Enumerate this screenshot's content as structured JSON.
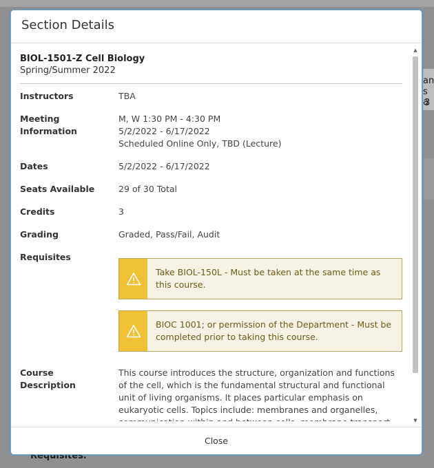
{
  "dialog": {
    "title": "Section Details",
    "close_label": "Close"
  },
  "course": {
    "code_title": "BIOL-1501-Z Cell Biology",
    "term": "Spring/Summer 2022"
  },
  "fields": {
    "instructors": {
      "label": "Instructors",
      "value": "TBA"
    },
    "meeting": {
      "label_line1": "Meeting",
      "label_line2": "Information",
      "line1": "M, W 1:30 PM - 4:30 PM",
      "line2": "5/2/2022 - 6/17/2022",
      "line3": "Scheduled Online Only, TBD (Lecture)"
    },
    "dates": {
      "label": "Dates",
      "value": "5/2/2022 - 6/17/2022"
    },
    "seats": {
      "label": "Seats Available",
      "value": "29 of 30 Total"
    },
    "credits": {
      "label": "Credits",
      "value": "3"
    },
    "grading": {
      "label": "Grading",
      "value": "Graded, Pass/Fail, Audit"
    },
    "requisites": {
      "label": "Requisites",
      "items": [
        "Take BIOL-150L - Must be taken at the same time as this course.",
        "BIOC 1001; or permission of the Department - Must be completed prior to taking this course."
      ]
    },
    "description": {
      "label_line1": "Course",
      "label_line2": "Description",
      "value": "This course introduces the structure, organization and functions of the cell, which is the fundamental structural and functional unit of living organisms. It places particular emphasis on eukaryotic cells. Topics include: membranes and organelles, communication within and between cells, membrane transport, the cell cycle, meiosis"
    }
  },
  "background": {
    "right_fragments": [
      "an",
      "s a",
      "3"
    ],
    "bottom_label": "Requisites:"
  },
  "colors": {
    "accent_border": "#6aa9dd",
    "warning_fill": "#f0c233",
    "warning_bg": "#f6f3e5",
    "warning_text": "#6d5a16"
  }
}
